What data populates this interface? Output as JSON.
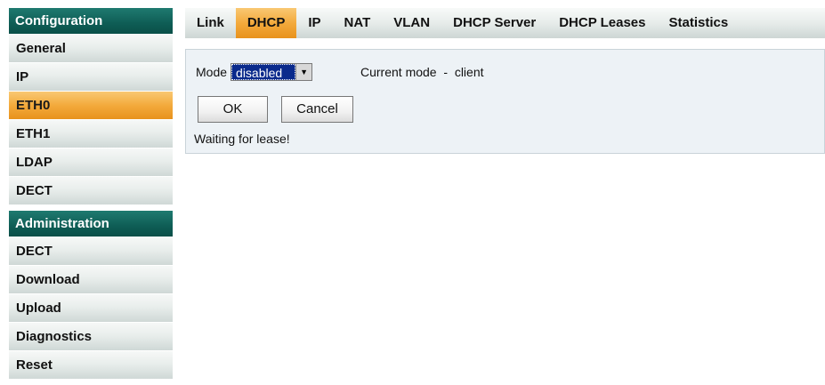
{
  "sidebar": {
    "configuration": {
      "header": "Configuration",
      "items": [
        {
          "label": "General",
          "active": false
        },
        {
          "label": "IP",
          "active": false
        },
        {
          "label": "ETH0",
          "active": true
        },
        {
          "label": "ETH1",
          "active": false
        },
        {
          "label": "LDAP",
          "active": false
        },
        {
          "label": "DECT",
          "active": false
        }
      ]
    },
    "administration": {
      "header": "Administration",
      "items": [
        {
          "label": "DECT",
          "active": false
        },
        {
          "label": "Download",
          "active": false
        },
        {
          "label": "Upload",
          "active": false
        },
        {
          "label": "Diagnostics",
          "active": false
        },
        {
          "label": "Reset",
          "active": false
        }
      ]
    }
  },
  "tabs": [
    {
      "label": "Link",
      "active": false
    },
    {
      "label": "DHCP",
      "active": true
    },
    {
      "label": "IP",
      "active": false
    },
    {
      "label": "NAT",
      "active": false
    },
    {
      "label": "VLAN",
      "active": false
    },
    {
      "label": "DHCP Server",
      "active": false
    },
    {
      "label": "DHCP Leases",
      "active": false
    },
    {
      "label": "Statistics",
      "active": false
    }
  ],
  "form": {
    "mode_label": "Mode",
    "mode_value": "disabled",
    "current_mode_text": "Current mode  -  client",
    "ok_label": "OK",
    "cancel_label": "Cancel",
    "status_message": "Waiting for lease!"
  },
  "colors": {
    "header_teal": "#0e5d55",
    "active_orange": "#f3aa3c",
    "panel_bg": "#edf2f6",
    "select_highlight": "#0a2a8c"
  },
  "icons": {
    "select_arrow": "dropdown-arrow-icon"
  }
}
